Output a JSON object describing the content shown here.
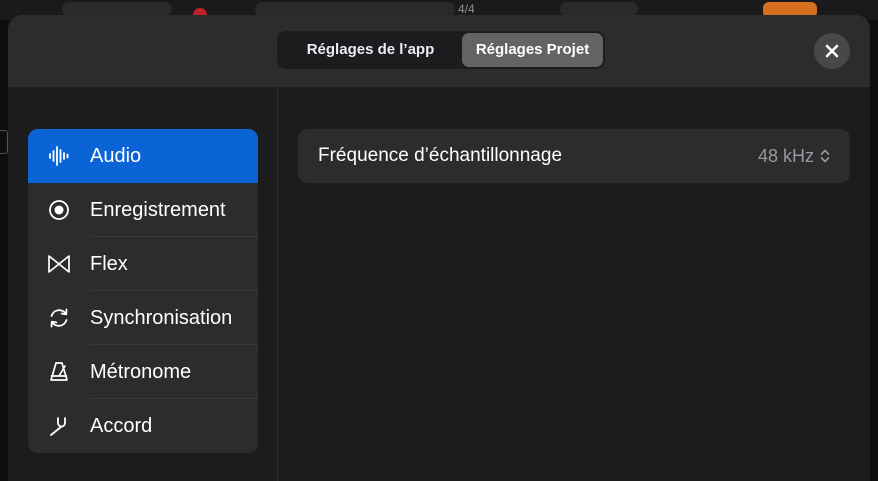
{
  "background": {
    "time_signature": "4/4"
  },
  "tabs": [
    {
      "label": "Réglages de l’app",
      "selected": false
    },
    {
      "label": "Réglages Projet",
      "selected": true
    }
  ],
  "close_icon": "close-icon",
  "sidebar": {
    "items": [
      {
        "label": "Audio",
        "icon": "waveform-icon",
        "selected": true
      },
      {
        "label": "Enregistrement",
        "icon": "record-icon",
        "selected": false
      },
      {
        "label": "Flex",
        "icon": "flex-icon",
        "selected": false
      },
      {
        "label": "Synchronisation",
        "icon": "sync-icon",
        "selected": false
      },
      {
        "label": "Métronome",
        "icon": "metronome-icon",
        "selected": false
      },
      {
        "label": "Accord",
        "icon": "tuning-fork-icon",
        "selected": false
      }
    ]
  },
  "main": {
    "sample_rate": {
      "label": "Fréquence d’échantillonnage",
      "value": "48 kHz"
    }
  },
  "colors": {
    "accent": "#0a64d6",
    "sheet": "#1c1c1e",
    "cell": "#2c2c2e",
    "secondary_text": "#98989d"
  }
}
